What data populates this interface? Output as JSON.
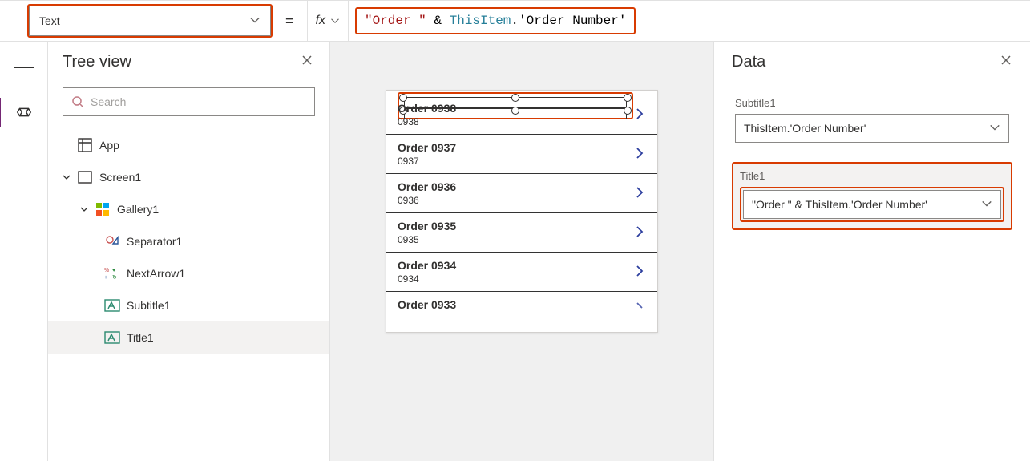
{
  "formula": {
    "property": "Text",
    "fx_label": "fx",
    "tokens": {
      "str": "\"Order \"",
      "amp": " & ",
      "item": "ThisItem",
      "dot": ".",
      "field": "'Order Number'"
    }
  },
  "tree": {
    "title": "Tree view",
    "search_placeholder": "Search",
    "nodes": {
      "app": "App",
      "screen": "Screen1",
      "gallery": "Gallery1",
      "separator": "Separator1",
      "nextarrow": "NextArrow1",
      "subtitle": "Subtitle1",
      "title": "Title1"
    }
  },
  "gallery": [
    {
      "title": "Order 0938",
      "sub": "0938",
      "selected": true,
      "chev": "full"
    },
    {
      "title": "Order 0937",
      "sub": "0937",
      "selected": false,
      "chev": "full"
    },
    {
      "title": "Order 0936",
      "sub": "0936",
      "selected": false,
      "chev": "full"
    },
    {
      "title": "Order 0935",
      "sub": "0935",
      "selected": false,
      "chev": "full"
    },
    {
      "title": "Order 0934",
      "sub": "0934",
      "selected": false,
      "chev": "full"
    },
    {
      "title": "Order 0933",
      "sub": "",
      "selected": false,
      "chev": "partial"
    }
  ],
  "data_panel": {
    "title": "Data",
    "subtitle_field": {
      "label": "Subtitle1",
      "value": "ThisItem.'Order Number'"
    },
    "title_field": {
      "label": "Title1",
      "value": "\"Order \" & ThisItem.'Order Number'"
    }
  }
}
